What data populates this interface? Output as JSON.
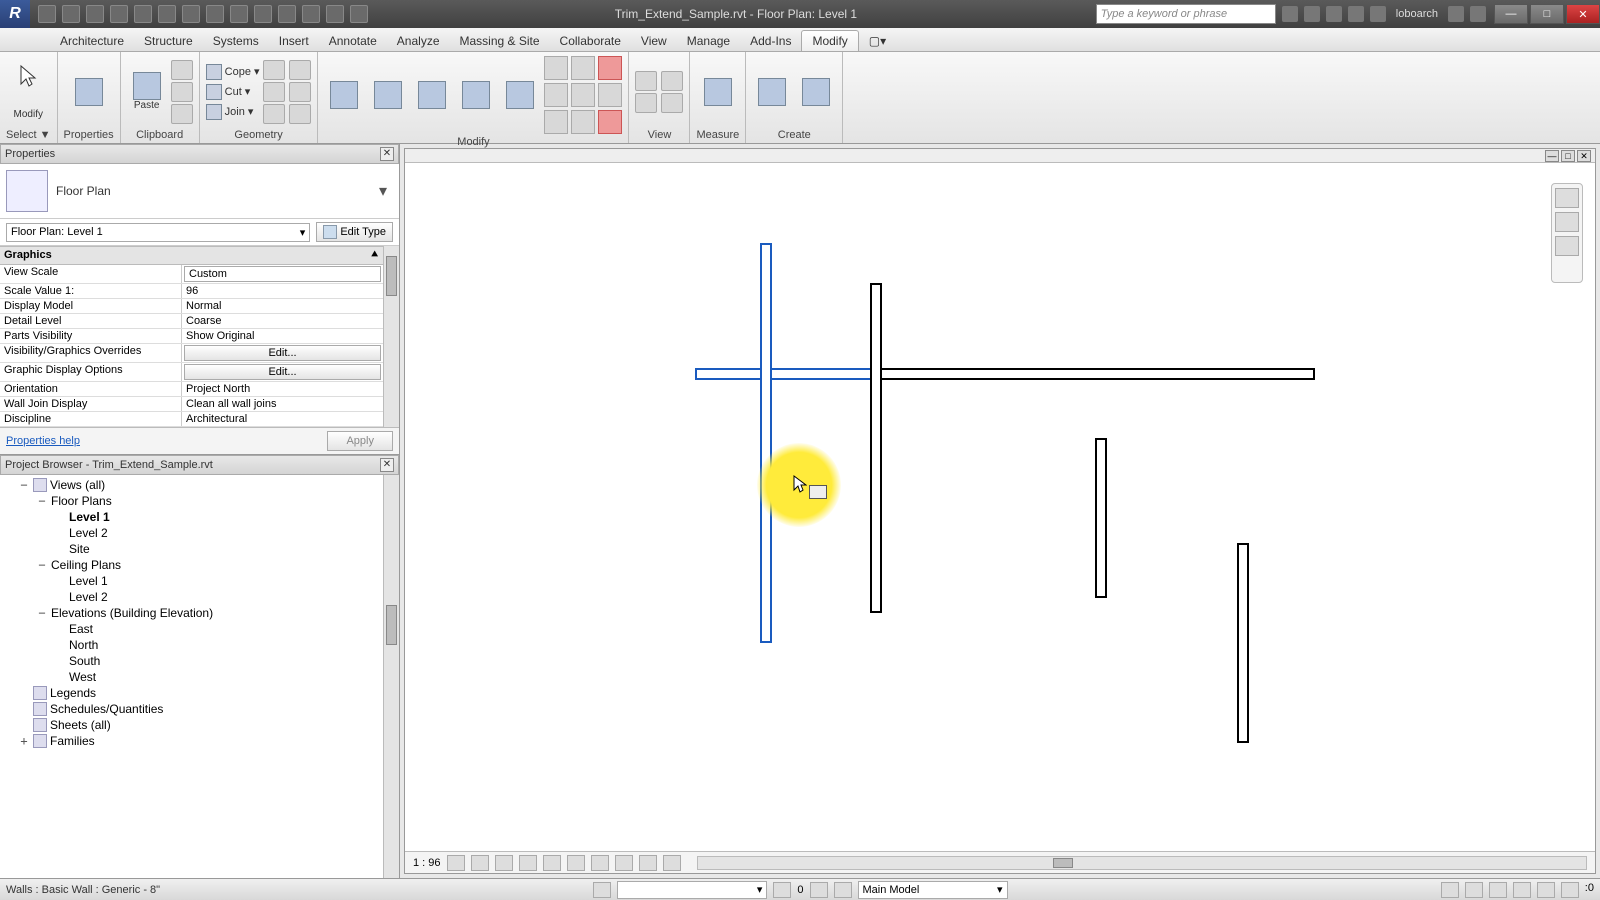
{
  "title": "Trim_Extend_Sample.rvt - Floor Plan: Level 1",
  "search_placeholder": "Type a keyword or phrase",
  "user": "loboarch",
  "ribbon_tabs": [
    "Architecture",
    "Structure",
    "Systems",
    "Insert",
    "Annotate",
    "Analyze",
    "Massing & Site",
    "Collaborate",
    "View",
    "Manage",
    "Add-Ins",
    "Modify"
  ],
  "active_tab": "Modify",
  "panels": {
    "select": "Select ▼",
    "properties": "Properties",
    "clipboard": "Clipboard",
    "geometry": "Geometry",
    "modify": "Modify",
    "view": "View",
    "measure": "Measure",
    "create": "Create"
  },
  "modify_btn": "Modify",
  "paste_btn": "Paste",
  "clipboard_cmds": {
    "cope": "Cope",
    "cut": "Cut",
    "join": "Join"
  },
  "properties_palette": {
    "title": "Properties",
    "type": "Floor Plan",
    "instance": "Floor Plan: Level 1",
    "edit_type": "Edit Type",
    "group": "Graphics",
    "rows": [
      {
        "k": "View Scale",
        "v": "Custom",
        "kind": "input"
      },
      {
        "k": "Scale Value    1:",
        "v": "96",
        "kind": "text"
      },
      {
        "k": "Display Model",
        "v": "Normal",
        "kind": "text"
      },
      {
        "k": "Detail Level",
        "v": "Coarse",
        "kind": "text"
      },
      {
        "k": "Parts Visibility",
        "v": "Show Original",
        "kind": "text"
      },
      {
        "k": "Visibility/Graphics Overrides",
        "v": "Edit...",
        "kind": "btn"
      },
      {
        "k": "Graphic Display Options",
        "v": "Edit...",
        "kind": "btn"
      },
      {
        "k": "Orientation",
        "v": "Project North",
        "kind": "text"
      },
      {
        "k": "Wall Join Display",
        "v": "Clean all wall joins",
        "kind": "text"
      },
      {
        "k": "Discipline",
        "v": "Architectural",
        "kind": "text"
      }
    ],
    "help": "Properties help",
    "apply": "Apply"
  },
  "browser": {
    "title": "Project Browser - Trim_Extend_Sample.rvt",
    "tree": [
      {
        "l": "Views (all)",
        "d": 1,
        "ex": "−",
        "ico": true
      },
      {
        "l": "Floor Plans",
        "d": 2,
        "ex": "−"
      },
      {
        "l": "Level 1",
        "d": 3,
        "bold": true
      },
      {
        "l": "Level 2",
        "d": 3
      },
      {
        "l": "Site",
        "d": 3
      },
      {
        "l": "Ceiling Plans",
        "d": 2,
        "ex": "−"
      },
      {
        "l": "Level 1",
        "d": 3
      },
      {
        "l": "Level 2",
        "d": 3
      },
      {
        "l": "Elevations (Building Elevation)",
        "d": 2,
        "ex": "−"
      },
      {
        "l": "East",
        "d": 3
      },
      {
        "l": "North",
        "d": 3
      },
      {
        "l": "South",
        "d": 3
      },
      {
        "l": "West",
        "d": 3
      },
      {
        "l": "Legends",
        "d": 1,
        "ico": true
      },
      {
        "l": "Schedules/Quantities",
        "d": 1,
        "ico": true
      },
      {
        "l": "Sheets (all)",
        "d": 1,
        "ico": true
      },
      {
        "l": "Families",
        "d": 1,
        "ex": "+",
        "ico": true
      }
    ]
  },
  "view_scale": "1 : 96",
  "status_text": "Walls : Basic Wall : Generic - 8\"",
  "workset": "Main Model",
  "zero": "0"
}
